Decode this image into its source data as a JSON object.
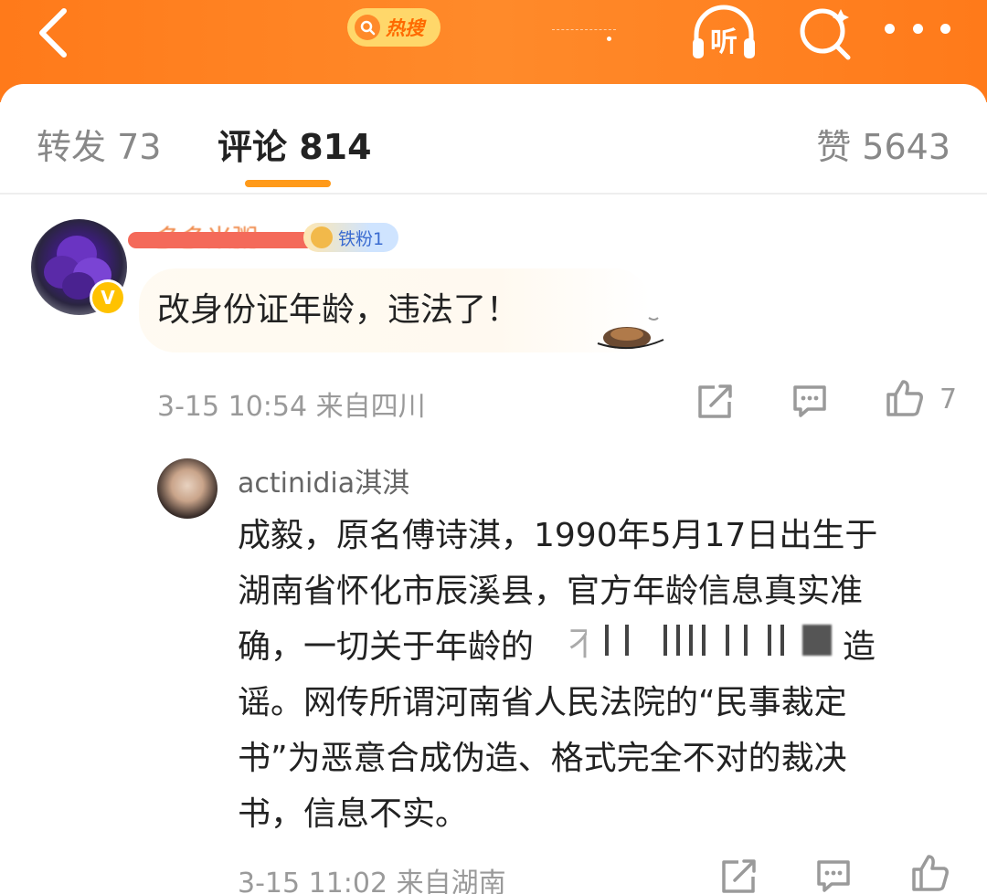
{
  "header": {
    "hot_search_label": "热搜",
    "listen_label": "听",
    "icons": [
      "back-icon",
      "search-icon",
      "more-icon",
      "headphones-icon"
    ],
    "accent_color": "#ff7a1a"
  },
  "tabs": {
    "repost": "转发 73",
    "comment": "评论 814",
    "like": "赞 5643",
    "active": "comment"
  },
  "comment": {
    "username_partial": "多多米粥",
    "fan_badge": "铁粉1",
    "verified_badge": "V",
    "text": "改身份证年龄，违法了！",
    "meta": "3-15 10:54  来自四川",
    "like_count": "7"
  },
  "reply": {
    "username": "actinidia淇淇",
    "lines": [
      "成毅，原名傅诗淇，1990年5月17日出生于",
      "湖南省怀化市辰溪县，官方年龄信息真实准",
      "确，一切关于年龄的",
      "谣。网传所谓河南省人民法院的“民事裁定",
      "书”为恶意合成伪造、格式完全不对的裁决",
      "书，信息不实。"
    ],
    "line3_visible_start": "不",
    "line3_visible_end": "意造",
    "meta": "3-15 11:02  来自湖南"
  }
}
